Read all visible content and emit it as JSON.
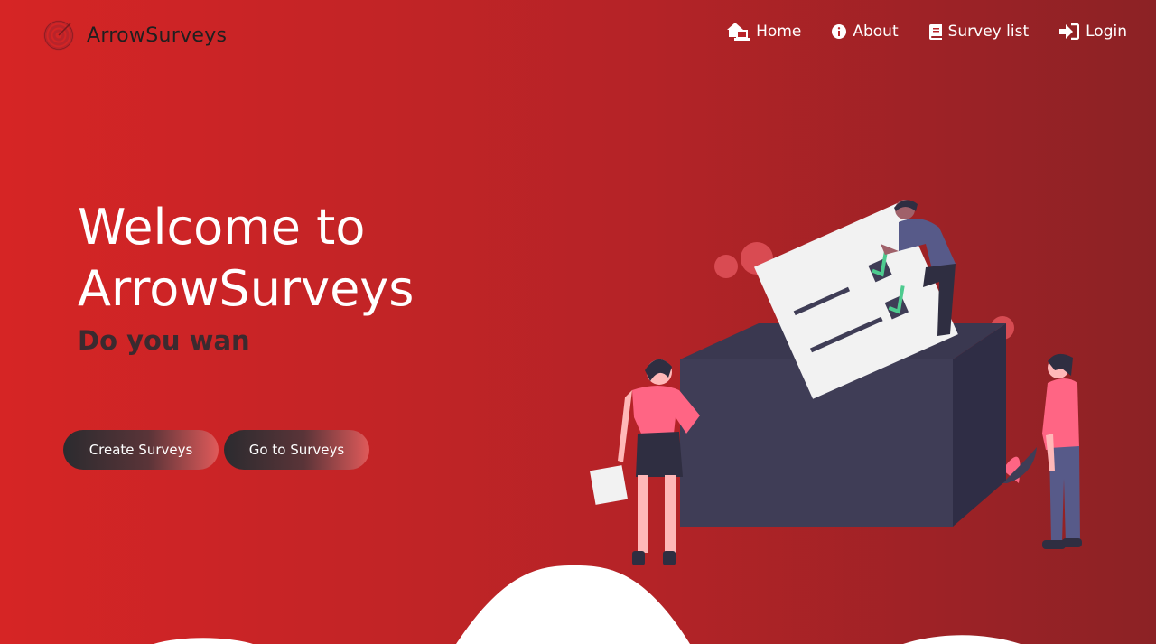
{
  "brand": {
    "name": "ArrowSurveys",
    "logo_icon": "target-icon"
  },
  "nav": {
    "items": [
      {
        "label": "Home",
        "icon": "home-laptop-icon"
      },
      {
        "label": "About",
        "icon": "info-icon"
      },
      {
        "label": "Survey list",
        "icon": "book-icon"
      },
      {
        "label": "Login",
        "icon": "sign-in-icon"
      }
    ]
  },
  "hero": {
    "title_line1": "Welcome to",
    "title_line2": "ArrowSurveys",
    "subtitle": "Do you wan"
  },
  "buttons": {
    "create_label": "Create Surveys",
    "go_label": "Go to Surveys"
  },
  "colors": {
    "background_start": "#d62525",
    "background_end": "#8c2225",
    "accent_pink": "#ff6584",
    "box_dark": "#3f3d56",
    "check_green": "#4ecb8f"
  }
}
